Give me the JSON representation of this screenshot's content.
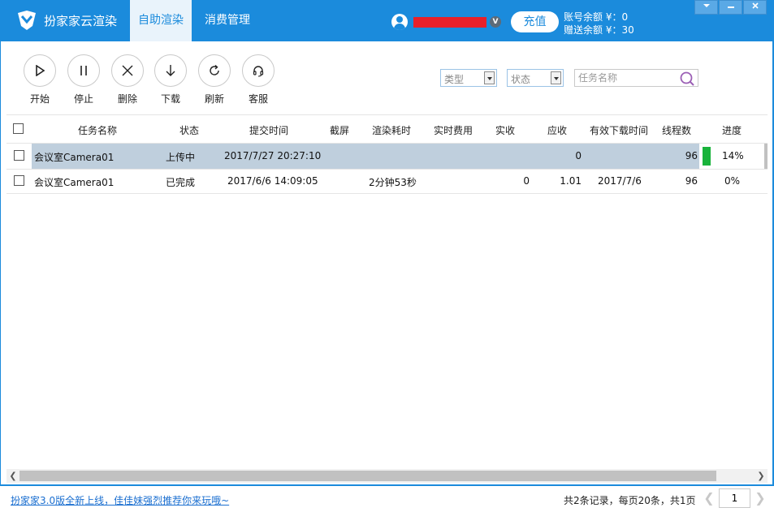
{
  "header": {
    "app_title": "扮家家云渲染",
    "tabs": [
      {
        "label": "自助渲染",
        "active": true
      },
      {
        "label": "消费管理",
        "active": false
      }
    ],
    "vip_badge": "V",
    "recharge_label": "充值",
    "account_balance": "账号余额 ¥：0",
    "gift_balance": "赠送余额 ¥：30",
    "window_controls": [
      "chevron-down-icon",
      "minimize-icon",
      "close-icon"
    ]
  },
  "toolbar": {
    "buttons": [
      {
        "label": "开始",
        "icon": "play-icon"
      },
      {
        "label": "停止",
        "icon": "pause-icon"
      },
      {
        "label": "删除",
        "icon": "close-icon"
      },
      {
        "label": "下载",
        "icon": "download-icon"
      },
      {
        "label": "刷新",
        "icon": "refresh-icon"
      },
      {
        "label": "客服",
        "icon": "headset-icon"
      }
    ]
  },
  "filters": {
    "type_value": "类型",
    "status_value": "状态",
    "search_placeholder": "任务名称"
  },
  "table": {
    "columns": [
      "任务名称",
      "状态",
      "提交时间",
      "截屏",
      "渲染耗时",
      "实时费用",
      "实收",
      "应收",
      "有效下载时间",
      "线程数",
      "进度"
    ],
    "rows": [
      {
        "name": "会议室Camera01",
        "status": "上传中",
        "submit_time": "2017/7/27 20:27:10",
        "screenshot": "",
        "render_time": "",
        "realtime_cost": "",
        "actual_received": "",
        "receivable": "0",
        "download_valid_until": "",
        "threads": "96",
        "progress": "14%",
        "progress_value": 0.14,
        "selected": true
      },
      {
        "name": "会议室Camera01",
        "status": "已完成",
        "submit_time": "2017/6/6 14:09:05",
        "screenshot": "",
        "render_time": "2分钟53秒",
        "realtime_cost": "",
        "actual_received": "0",
        "receivable": "1.01",
        "download_valid_until": "2017/7/6",
        "threads": "96",
        "progress": "0%",
        "progress_value": 0,
        "selected": false
      }
    ]
  },
  "colors": {
    "primary": "#1b8bdc",
    "selected_row": "#bfcfdd",
    "progress": "#19b33b",
    "redaction": "#e8202a"
  },
  "footer": {
    "promo_link": "扮家家3.0版全新上线，佳佳妹强烈推荐你来玩哦~",
    "page_info": "共2条记录，每页20条，共1页",
    "page_number": "1"
  }
}
